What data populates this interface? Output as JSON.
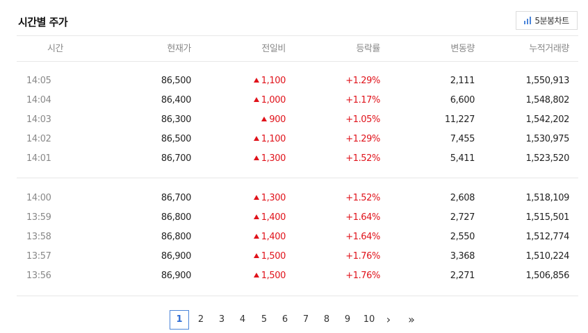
{
  "title": "시간별 주가",
  "chart_button": {
    "label": "5분봉차트",
    "icon": "bar-chart-icon"
  },
  "columns": [
    "시간",
    "현재가",
    "전일비",
    "등락률",
    "변동량",
    "누적거래량"
  ],
  "colors": {
    "up": "#e0121a",
    "accent": "#4a84d9"
  },
  "groups": [
    [
      {
        "time": "14:05",
        "price": "86,500",
        "change": "1,100",
        "rate": "+1.29%",
        "volume": "2,111",
        "cumulative": "1,550,913"
      },
      {
        "time": "14:04",
        "price": "86,400",
        "change": "1,000",
        "rate": "+1.17%",
        "volume": "6,600",
        "cumulative": "1,548,802"
      },
      {
        "time": "14:03",
        "price": "86,300",
        "change": "900",
        "rate": "+1.05%",
        "volume": "11,227",
        "cumulative": "1,542,202"
      },
      {
        "time": "14:02",
        "price": "86,500",
        "change": "1,100",
        "rate": "+1.29%",
        "volume": "7,455",
        "cumulative": "1,530,975"
      },
      {
        "time": "14:01",
        "price": "86,700",
        "change": "1,300",
        "rate": "+1.52%",
        "volume": "5,411",
        "cumulative": "1,523,520"
      }
    ],
    [
      {
        "time": "14:00",
        "price": "86,700",
        "change": "1,300",
        "rate": "+1.52%",
        "volume": "2,608",
        "cumulative": "1,518,109"
      },
      {
        "time": "13:59",
        "price": "86,800",
        "change": "1,400",
        "rate": "+1.64%",
        "volume": "2,727",
        "cumulative": "1,515,501"
      },
      {
        "time": "13:58",
        "price": "86,800",
        "change": "1,400",
        "rate": "+1.64%",
        "volume": "2,550",
        "cumulative": "1,512,774"
      },
      {
        "time": "13:57",
        "price": "86,900",
        "change": "1,500",
        "rate": "+1.76%",
        "volume": "3,368",
        "cumulative": "1,510,224"
      },
      {
        "time": "13:56",
        "price": "86,900",
        "change": "1,500",
        "rate": "+1.76%",
        "volume": "2,271",
        "cumulative": "1,506,856"
      }
    ]
  ],
  "pagination": {
    "pages": [
      "1",
      "2",
      "3",
      "4",
      "5",
      "6",
      "7",
      "8",
      "9",
      "10"
    ],
    "current": "1",
    "next": "›",
    "last": "»"
  }
}
